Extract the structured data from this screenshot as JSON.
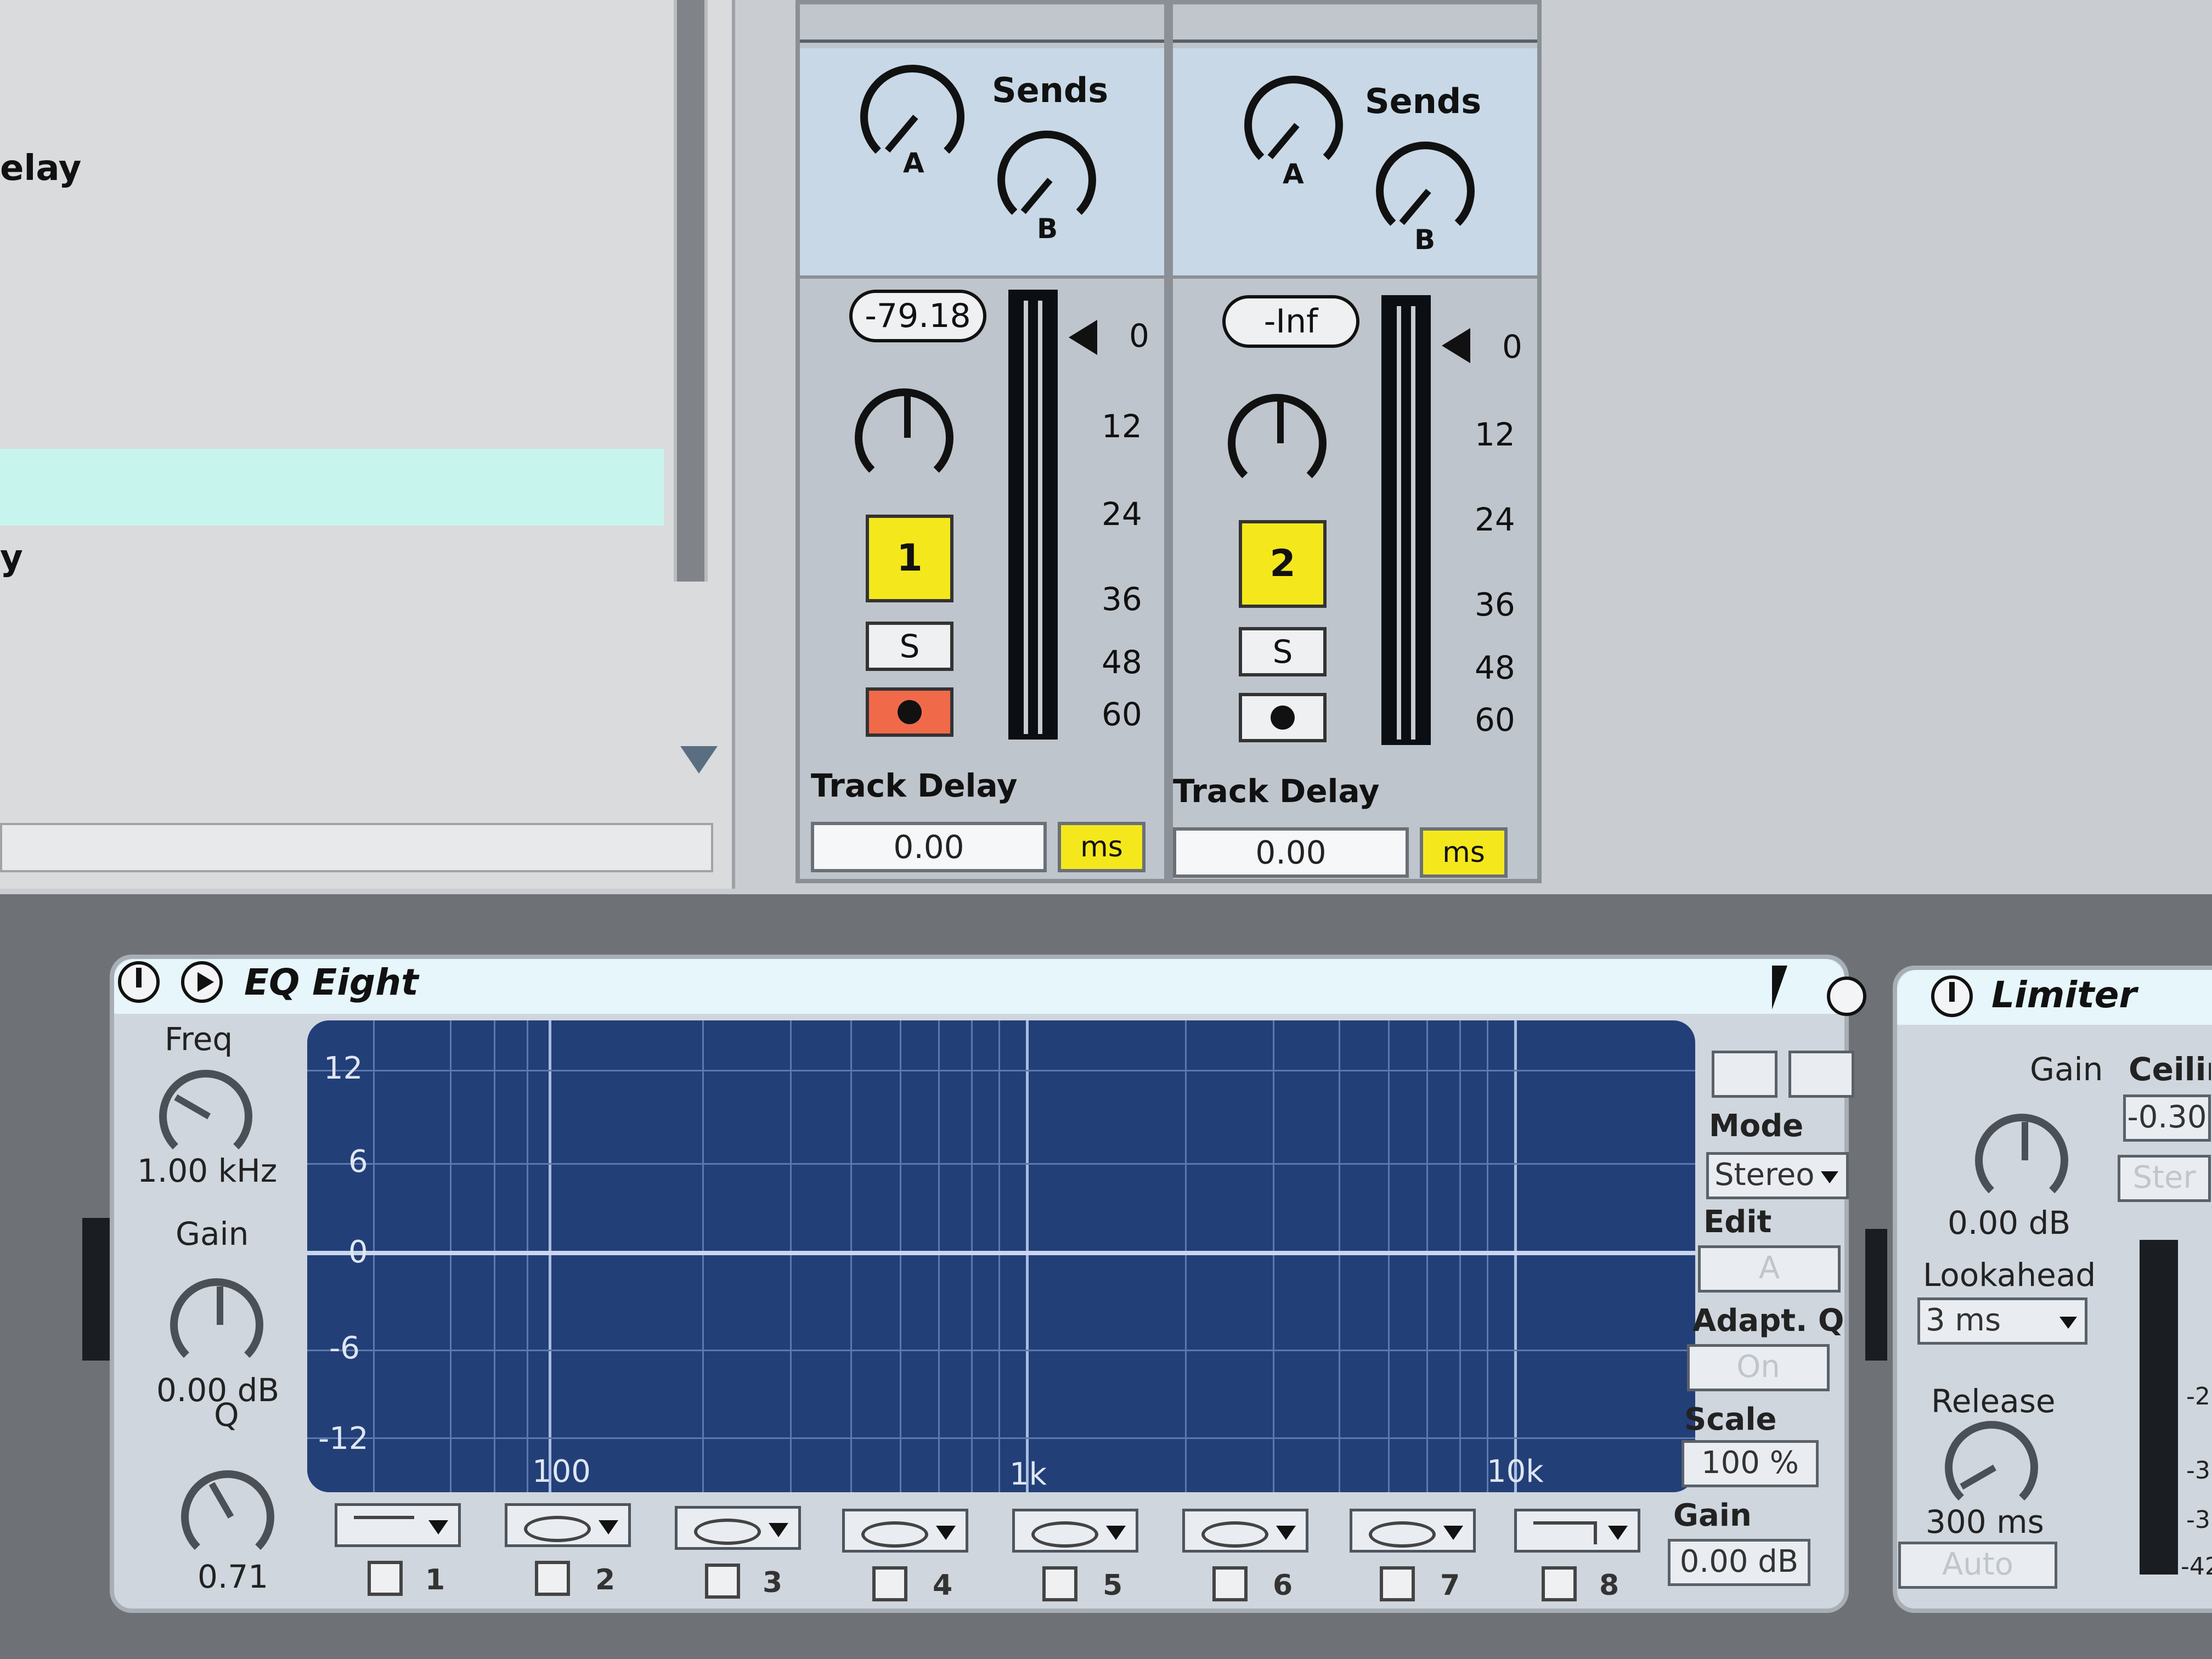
{
  "browser": {
    "labels": [
      "elay",
      "y"
    ]
  },
  "mixer": {
    "tracks": [
      {
        "sends_label": "Sends",
        "send_a": "A",
        "send_b": "B",
        "volume": "-79.18",
        "number": "1",
        "solo": "S",
        "meter_scale": [
          "0",
          "12",
          "24",
          "36",
          "48",
          "60"
        ],
        "delay_label": "Track Delay",
        "delay_value": "0.00",
        "delay_unit": "ms",
        "arm_color": "#f06a4a"
      },
      {
        "sends_label": "Sends",
        "send_a": "A",
        "send_b": "B",
        "volume": "-Inf",
        "number": "2",
        "solo": "S",
        "meter_scale": [
          "0",
          "12",
          "24",
          "36",
          "48",
          "60"
        ],
        "delay_label": "Track Delay",
        "delay_value": "0.00",
        "delay_unit": "ms",
        "arm_color": "#eef0f2"
      }
    ]
  },
  "eq": {
    "title": "EQ Eight",
    "freq_label": "Freq",
    "freq_value": "1.00 kHz",
    "gain_label": "Gain",
    "gain_value": "0.00 dB",
    "q_label": "Q",
    "q_value": "0.71",
    "y_labels": [
      "12",
      "6",
      "0",
      "-6",
      "-12"
    ],
    "x_labels": [
      "100",
      "1k",
      "10k"
    ],
    "bands": [
      "1",
      "2",
      "3",
      "4",
      "5",
      "6",
      "7",
      "8"
    ],
    "mode_label": "Mode",
    "mode_value": "Stereo",
    "edit_label": "Edit",
    "edit_value": "A",
    "adaptq_label": "Adapt. Q",
    "adaptq_value": "On",
    "scale_label": "Scale",
    "scale_value": "100 %",
    "out_gain_label": "Gain",
    "out_gain_value": "0.00 dB",
    "graph_color": "#233f78"
  },
  "limiter": {
    "title": "Limiter",
    "gain_label": "Gain",
    "gain_value": "0.00 dB",
    "ceiling_label": "Ceilin",
    "ceiling_value": "-0.30",
    "stereo_label": "Ster",
    "lookahead_label": "Lookahead",
    "lookahead_value": "3 ms",
    "release_label": "Release",
    "release_value": "300 ms",
    "auto_label": "Auto",
    "meter_scale": [
      "-2",
      "-3",
      "-3",
      "-42"
    ]
  },
  "colors": {
    "track_yellow": "#f4e81c",
    "arm_red": "#f06a4a",
    "title_bar": "#e6f6fb"
  }
}
